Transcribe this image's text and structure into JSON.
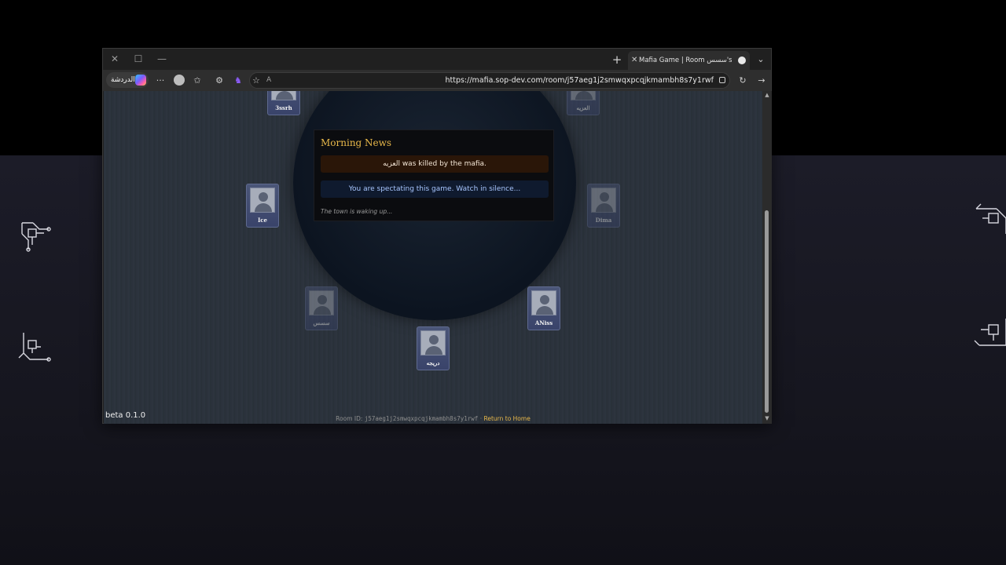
{
  "window": {
    "tab_title": "Mafia Game | Room سسس's Custom",
    "url": "https://mafia.sop-dev.com/room/j57aeg1j2smwqxpcqjkmambh8s7y1rwf",
    "copilot_label": "الدردشة",
    "controls": {
      "close": "✕",
      "maximize": "☐",
      "minimize": "—"
    },
    "icons": [
      "close-icon",
      "maximize-icon",
      "minimize-icon",
      "new-tab-icon",
      "tab-list-icon",
      "more-icon",
      "profile-icon",
      "favorites-icon",
      "extensions-icon",
      "read-aloud-icon",
      "refresh-icon",
      "forward-icon",
      "lock-icon"
    ]
  },
  "game": {
    "news_title": "Morning News",
    "kill_message": "العزيه was killed by the mafia.",
    "spectate_message": "You are spectating this game. Watch in silence...",
    "status_text": "The town is waking up...",
    "players": [
      {
        "name": "3ssrh",
        "alive": true
      },
      {
        "name": "العزيه",
        "alive": false
      },
      {
        "name": "Ice",
        "alive": true
      },
      {
        "name": "Dima",
        "alive": false
      },
      {
        "name": "سسس",
        "alive": false
      },
      {
        "name": "ANiss",
        "alive": true
      },
      {
        "name": "دريجه",
        "alive": true
      }
    ]
  },
  "footer": {
    "version": "beta 0.1.0",
    "room_prefix": "Room ID:",
    "room_id": "j57aeg1j2smwqxpcqjkmambh8s7y1rwf",
    "separator": "·",
    "return_link": "Return to Home"
  }
}
